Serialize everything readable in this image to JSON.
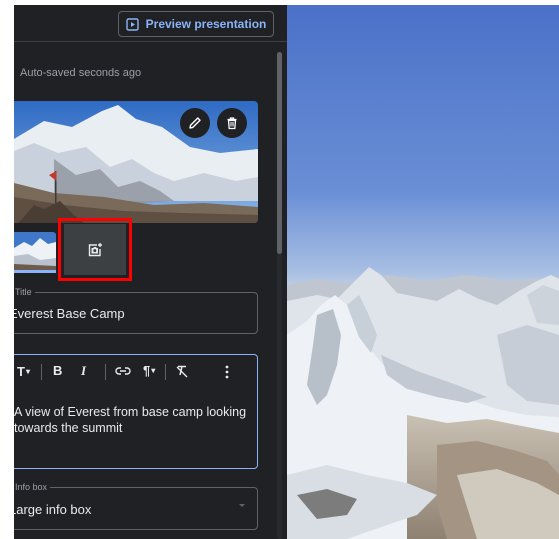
{
  "toolbar": {
    "preview_label": "Preview presentation",
    "preview_icon": "play-box-icon"
  },
  "status": {
    "autosave": "Auto-saved seconds ago"
  },
  "photos": {
    "main_photo": "mount-everest-photo",
    "edit_icon": "pencil-icon",
    "delete_icon": "trash-icon",
    "add_icon": "add-photo-icon"
  },
  "title_field": {
    "label": "Title",
    "value": "Everest Base Camp"
  },
  "description_editor": {
    "text": "A view of Everest from base camp looking towards the summit"
  },
  "info_box_field": {
    "label": "Info box",
    "value": "Large info box"
  },
  "colors": {
    "panel_bg": "#202124",
    "accent": "#8ab4f8",
    "highlight": "#ff0000"
  }
}
